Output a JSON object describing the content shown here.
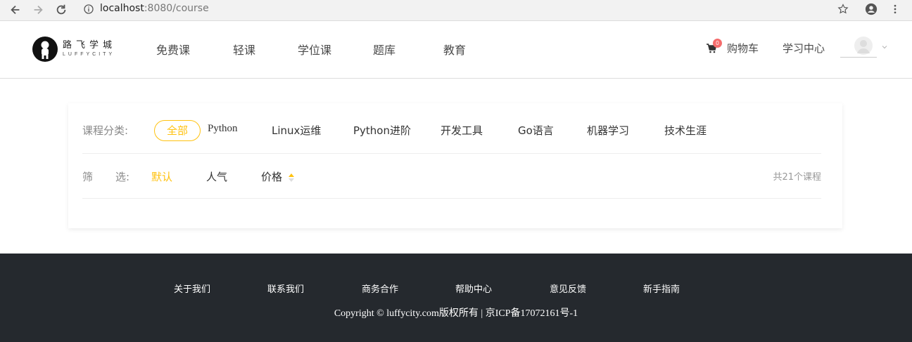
{
  "browser": {
    "url_host": "localhost",
    "url_rest": ":8080/course"
  },
  "header": {
    "logo_cn": "路飞学城",
    "logo_en": "LUFFYCITY",
    "nav": [
      "免费课",
      "轻课",
      "学位课",
      "题库",
      "教育"
    ],
    "cart_label": "购物车",
    "cart_count": "0",
    "study_center": "学习中心"
  },
  "filter": {
    "category_label": "课程分类:",
    "categories": [
      "全部",
      "Python",
      "Linux运维",
      "Python进阶",
      "开发工具",
      "Go语言",
      "机器学习",
      "技术生涯"
    ],
    "active_category": "全部",
    "sort_label_1": "筛",
    "sort_label_2": "选:",
    "sorts": [
      "默认",
      "人气",
      "价格"
    ],
    "active_sort": "默认",
    "course_count": "共21个课程"
  },
  "footer": {
    "links": [
      "关于我们",
      "联系我们",
      "商务合作",
      "帮助中心",
      "意见反馈",
      "新手指南"
    ],
    "copyright": "Copyright © luffycity.com版权所有 | 京ICP备17072161号-1"
  },
  "colors": {
    "accent": "#ffc210",
    "footer_bg": "#25292e",
    "badge": "#f56c6c"
  }
}
